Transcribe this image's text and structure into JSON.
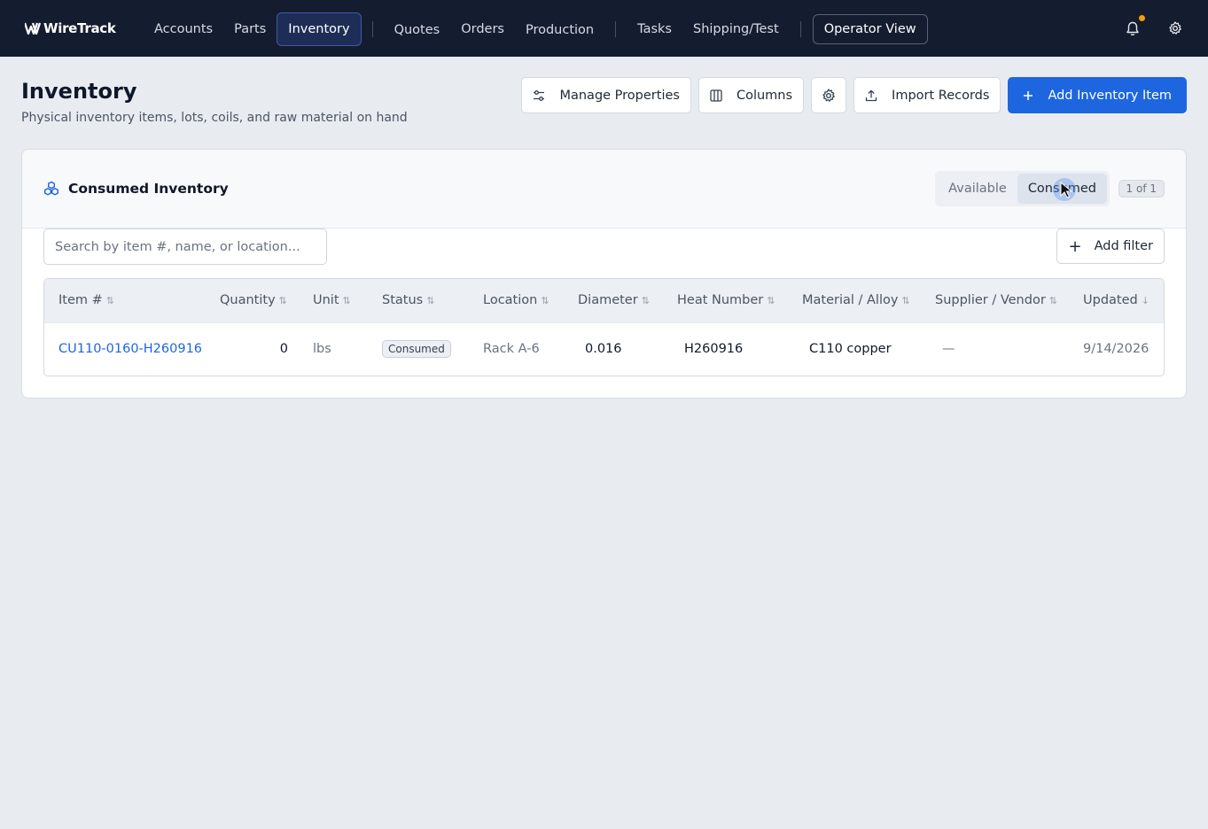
{
  "app": {
    "logo_text": "WireTrack",
    "accent_color": "#1d66e0",
    "nav_bg": "#141c2f"
  },
  "nav": {
    "group1": [
      {
        "label": "Accounts",
        "active": false
      },
      {
        "label": "Parts",
        "active": false
      },
      {
        "label": "Inventory",
        "active": true
      }
    ],
    "group2": [
      {
        "label": "Quotes"
      },
      {
        "label": "Orders"
      },
      {
        "label": "Production"
      }
    ],
    "group3": [
      {
        "label": "Tasks"
      },
      {
        "label": "Shipping/Test"
      }
    ],
    "operator_view": "Operator View",
    "icons": [
      "bell-icon",
      "gear-icon"
    ]
  },
  "header": {
    "title": "Inventory",
    "subtitle": "Physical inventory items, lots, coils, and raw material on hand",
    "manage_properties": "Manage Properties",
    "columns": "Columns",
    "import_records": "Import Records",
    "add_item": "Add Inventory Item"
  },
  "card": {
    "title": "Consumed Inventory",
    "seg_available": "Available",
    "seg_consumed": "Consumed",
    "count": "1 of 1",
    "search_placeholder": "Search by item #, name, or location...",
    "add_filter": "Add filter"
  },
  "table": {
    "columns": [
      "Item #",
      "Quantity",
      "Unit",
      "Status",
      "Location",
      "Diameter",
      "Heat Number",
      "Material / Alloy",
      "Supplier / Vendor",
      "Updated"
    ],
    "rows": [
      {
        "item": "CU110-0160-H260916",
        "quantity": "0",
        "unit": "lbs",
        "status": "Consumed",
        "location": "Rack A-6",
        "diameter": "0.016",
        "heat": "H260916",
        "material": "C110 copper",
        "supplier": "—",
        "updated": "9/14/2026"
      }
    ]
  }
}
